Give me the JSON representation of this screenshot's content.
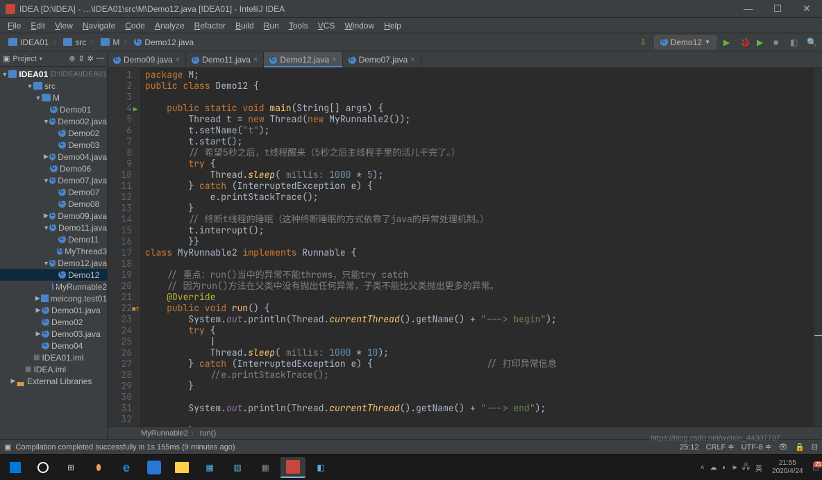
{
  "window": {
    "title": "IDEA [D:\\IDEA] - …\\IDEA01\\src\\M\\Demo12.java [IDEA01] - IntelliJ IDEA"
  },
  "menu": [
    "File",
    "Edit",
    "View",
    "Navigate",
    "Code",
    "Analyze",
    "Refactor",
    "Build",
    "Run",
    "Tools",
    "VCS",
    "Window",
    "Help"
  ],
  "breadcrumb": [
    "IDEA01",
    "src",
    "M",
    "Demo12.java"
  ],
  "runConfig": "Demo12",
  "projectPane": {
    "title": "Project",
    "root": {
      "name": "IDEA01",
      "path": "D:\\IDEA\\IDEA01"
    },
    "tree": [
      {
        "d": 1,
        "ic": "folder",
        "exp": true,
        "label": "src"
      },
      {
        "d": 2,
        "ic": "folder",
        "exp": true,
        "label": "M"
      },
      {
        "d": 3,
        "ic": "java",
        "leaf": true,
        "label": "Demo01"
      },
      {
        "d": 3,
        "ic": "java",
        "exp": true,
        "label": "Demo02.java"
      },
      {
        "d": 4,
        "ic": "java",
        "leaf": true,
        "label": "Demo02"
      },
      {
        "d": 4,
        "ic": "java",
        "leaf": true,
        "label": "Demo03"
      },
      {
        "d": 3,
        "ic": "java",
        "arrow": true,
        "label": "Demo04.java"
      },
      {
        "d": 3,
        "ic": "java",
        "leaf": true,
        "label": "Demo06"
      },
      {
        "d": 3,
        "ic": "java",
        "exp": true,
        "label": "Demo07.java"
      },
      {
        "d": 4,
        "ic": "java",
        "leaf": true,
        "label": "Demo07"
      },
      {
        "d": 4,
        "ic": "java",
        "leaf": true,
        "label": "Demo08"
      },
      {
        "d": 3,
        "ic": "java",
        "arrow": true,
        "label": "Demo09.java"
      },
      {
        "d": 3,
        "ic": "java",
        "exp": true,
        "label": "Demo11.java"
      },
      {
        "d": 4,
        "ic": "java",
        "leaf": true,
        "label": "Demo11"
      },
      {
        "d": 4,
        "ic": "java",
        "leaf": true,
        "label": "MyThread3"
      },
      {
        "d": 3,
        "ic": "java",
        "exp": true,
        "label": "Demo12.java"
      },
      {
        "d": 4,
        "ic": "java",
        "leaf": true,
        "sel": true,
        "label": "Demo12"
      },
      {
        "d": 4,
        "ic": "java",
        "leaf": true,
        "label": "MyRunnable2"
      },
      {
        "d": 2,
        "ic": "folder",
        "arrow": true,
        "label": "meicong.test01"
      },
      {
        "d": 2,
        "ic": "java",
        "arrow": true,
        "label": "Demo01.java"
      },
      {
        "d": 2,
        "ic": "java",
        "leaf": true,
        "label": "Demo02"
      },
      {
        "d": 2,
        "ic": "java",
        "arrow": true,
        "label": "Demo03.java"
      },
      {
        "d": 2,
        "ic": "java",
        "leaf": true,
        "label": "Demo04"
      },
      {
        "d": 1,
        "ic": "iml",
        "leaf": true,
        "label": "IDEA01.iml"
      },
      {
        "d": 0,
        "ic": "iml",
        "leaf": true,
        "label": "IDEA.iml"
      },
      {
        "d": -1,
        "ic": "lib",
        "arrow": true,
        "label": "External Libraries"
      }
    ]
  },
  "tabs": [
    {
      "label": "Demo09.java",
      "active": false
    },
    {
      "label": "Demo11.java",
      "active": false
    },
    {
      "label": "Demo12.java",
      "active": true
    },
    {
      "label": "Demo07.java",
      "active": false
    }
  ],
  "gutter": {
    "lines": 33,
    "marks": {
      "4": "run",
      "22": "impl"
    }
  },
  "code": [
    [
      [
        "kw",
        "package "
      ],
      [
        "pl",
        "M"
      ],
      [
        "pl",
        ";"
      ]
    ],
    [
      [
        "kw",
        "public class "
      ],
      [
        "cls",
        "Demo12 "
      ],
      [
        "pl",
        "{"
      ]
    ],
    [],
    [
      [
        "pl",
        "    "
      ],
      [
        "kw",
        "public static void "
      ],
      [
        "mtd",
        "main"
      ],
      [
        "pl",
        "(String[] args) {"
      ]
    ],
    [
      [
        "pl",
        "        Thread "
      ],
      [
        "cls",
        "t "
      ],
      [
        "pl",
        "= "
      ],
      [
        "kw",
        "new "
      ],
      [
        "pl",
        "Thread("
      ],
      [
        "kw",
        "new "
      ],
      [
        "pl",
        "MyRunnable2());"
      ]
    ],
    [
      [
        "pl",
        "        "
      ],
      [
        "cls",
        "t"
      ],
      [
        "pl",
        ".setName("
      ],
      [
        "str",
        "\"t\""
      ],
      [
        "pl",
        ");"
      ]
    ],
    [
      [
        "pl",
        "        "
      ],
      [
        "cls",
        "t"
      ],
      [
        "pl",
        ".start();"
      ]
    ],
    [
      [
        "pl",
        "        "
      ],
      [
        "cmt",
        "// 希望5秒之后，t线程醒来（5秒之后主线程手里的活儿干完了。）"
      ]
    ],
    [
      [
        "pl",
        "        "
      ],
      [
        "kw",
        "try "
      ],
      [
        "pl",
        "{"
      ]
    ],
    [
      [
        "pl",
        "            Thread."
      ],
      [
        "smtd",
        "sleep"
      ],
      [
        "pl",
        "( "
      ],
      [
        "param",
        "millis: "
      ],
      [
        "num",
        "1000 "
      ],
      [
        "pl",
        "* "
      ],
      [
        "num",
        "5"
      ],
      [
        "pl",
        ");"
      ]
    ],
    [
      [
        "pl",
        "        } "
      ],
      [
        "kw",
        "catch "
      ],
      [
        "pl",
        "(InterruptedException "
      ],
      [
        "cls",
        "e"
      ],
      [
        "pl",
        ") {"
      ]
    ],
    [
      [
        "pl",
        "            "
      ],
      [
        "cls",
        "e"
      ],
      [
        "pl",
        ".printStackTrace();"
      ]
    ],
    [
      [
        "pl",
        "        }"
      ]
    ],
    [
      [
        "pl",
        "        "
      ],
      [
        "cmt",
        "// 终断t线程的睡眠（这种终断睡眠的方式依靠了java的异常处理机制。）"
      ]
    ],
    [
      [
        "pl",
        "        "
      ],
      [
        "cls",
        "t"
      ],
      [
        "pl",
        ".interrupt();"
      ]
    ],
    [
      [
        "pl",
        "        }}"
      ]
    ],
    [
      [
        "kw",
        "class "
      ],
      [
        "cls",
        "MyRunnable2 "
      ],
      [
        "kw",
        "implements "
      ],
      [
        "cls",
        "Runnable "
      ],
      [
        "pl",
        "{"
      ]
    ],
    [],
    [
      [
        "pl",
        "    "
      ],
      [
        "cmt",
        "// 重点：run()当中的异常不能throws，只能try catch"
      ]
    ],
    [
      [
        "pl",
        "    "
      ],
      [
        "cmt",
        "// 因为run()方法在父类中没有抛出任何异常，子类不能比父类抛出更多的异常。"
      ]
    ],
    [
      [
        "pl",
        "    "
      ],
      [
        "ann",
        "@Override"
      ]
    ],
    [
      [
        "pl",
        "    "
      ],
      [
        "kw",
        "public void "
      ],
      [
        "mtd",
        "run"
      ],
      [
        "pl",
        "() {"
      ]
    ],
    [
      [
        "pl",
        "        System."
      ],
      [
        "fld",
        "out"
      ],
      [
        "pl",
        ".println(Thread."
      ],
      [
        "smtd",
        "currentThread"
      ],
      [
        "pl",
        "().getName() + "
      ],
      [
        "str",
        "\"---> begin\""
      ],
      [
        "pl",
        ");"
      ]
    ],
    [
      [
        "pl",
        "        "
      ],
      [
        "kw",
        "try "
      ],
      [
        "pl",
        "{"
      ]
    ],
    [
      [
        "pl",
        "            "
      ]
    ],
    [
      [
        "pl",
        "            Thread."
      ],
      [
        "smtd",
        "sleep"
      ],
      [
        "pl",
        "( "
      ],
      [
        "param",
        "millis: "
      ],
      [
        "num",
        "1000 "
      ],
      [
        "pl",
        "* "
      ],
      [
        "num",
        "10"
      ],
      [
        "pl",
        ");"
      ]
    ],
    [
      [
        "pl",
        "        } "
      ],
      [
        "kw",
        "catch "
      ],
      [
        "pl",
        "(InterruptedException "
      ],
      [
        "cls",
        "e"
      ],
      [
        "pl",
        ") {                     "
      ],
      [
        "cmt",
        "// 打印异常信息"
      ]
    ],
    [
      [
        "pl",
        "            "
      ],
      [
        "cmt",
        "//e.printStackTrace();"
      ]
    ],
    [
      [
        "pl",
        "        }"
      ]
    ],
    [],
    [
      [
        "pl",
        "        System."
      ],
      [
        "fld",
        "out"
      ],
      [
        "pl",
        ".println(Thread."
      ],
      [
        "smtd",
        "currentThread"
      ],
      [
        "pl",
        "().getName() + "
      ],
      [
        "str",
        "\"---> end\""
      ],
      [
        "pl",
        ");"
      ]
    ],
    [],
    [
      [
        "pl",
        "        }"
      ]
    ]
  ],
  "crumbs": [
    "MyRunnable2",
    "run()"
  ],
  "status": {
    "msg": "Compilation completed successfully in 1s 155ms (9 minutes ago)",
    "caret": "25:12",
    "ending": "CRLF",
    "encoding": "UTF-8",
    "madeEasy": ""
  },
  "clock": {
    "time": "21:55",
    "date": "2020/4/24"
  },
  "watermark": "https://blog.csdn.net/weixin_44307737"
}
